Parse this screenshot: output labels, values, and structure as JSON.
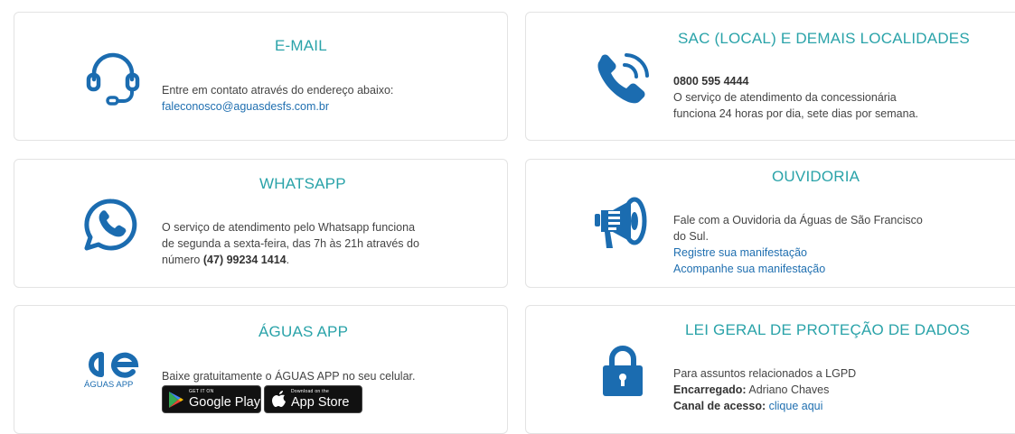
{
  "email": {
    "title": "E-MAIL",
    "description": "Entre em contato através do endereço abaixo:",
    "address": "faleconosco@aguasdesfs.com.br"
  },
  "sac": {
    "title": "SAC (LOCAL) E DEMAIS LOCALIDADES",
    "phone": "0800 595 4444",
    "line1": "O serviço de atendimento da concessionária",
    "line2": "funciona 24 horas por dia, sete dias por semana."
  },
  "whatsapp": {
    "title": "WHATSAPP",
    "line1": "O serviço de atendimento pelo Whatsapp funciona",
    "line2": "de segunda a sexta-feira, das 7h às 21h através do",
    "line3_prefix": "número",
    "number": "(47) 99234 1414",
    "line3_suffix": "."
  },
  "ouvidoria": {
    "title": "OUVIDORIA",
    "line1": "Fale com a Ouvidoria da Águas de São Francisco",
    "line2": "do Sul.",
    "link_register": "Registre sua manifestação",
    "link_follow": "Acompanhe sua manifestação"
  },
  "app": {
    "title": "ÁGUAS APP",
    "logo_text": "ÁGUAS APP",
    "description": "Baixe gratuitamente o ÁGUAS APP no seu celular.",
    "google_small": "GET IT ON",
    "google_big": "Google Play",
    "apple_small": "Download on the",
    "apple_big": "App Store"
  },
  "lgpd": {
    "title": "LEI GERAL DE PROTEÇÃO DE DADOS",
    "line1": "Para assuntos relacionados a LGPD",
    "manager_label": "Encarregado:",
    "manager_name": "Adriano Chaves",
    "channel_label": "Canal de acesso:",
    "channel_link": "clique aqui"
  },
  "colors": {
    "accent": "#2aa3a9",
    "icon_blue": "#1b6cb0",
    "link": "#1f6fb0"
  }
}
